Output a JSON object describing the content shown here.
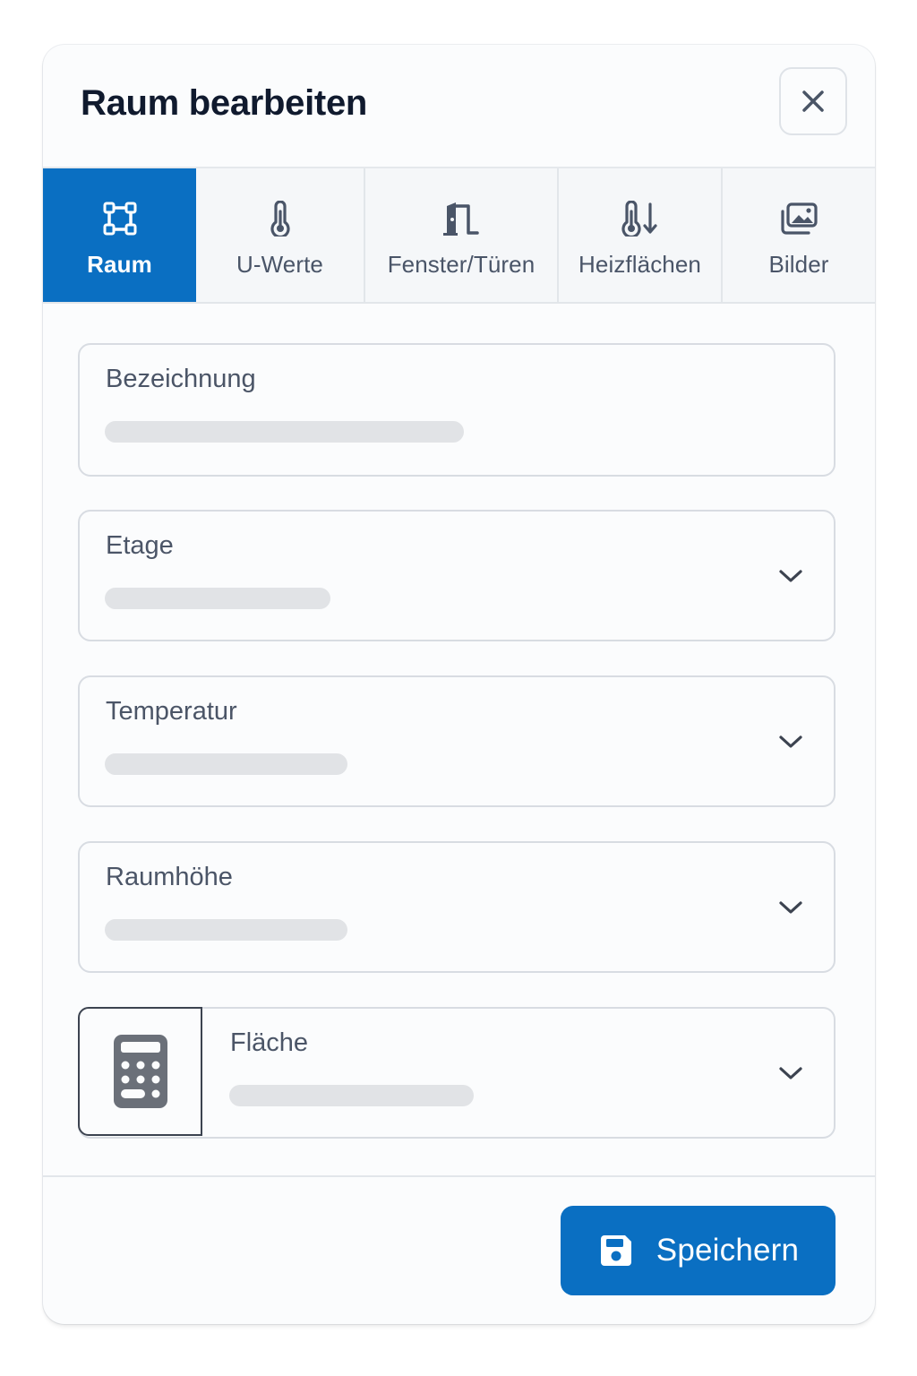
{
  "dialog": {
    "title": "Raum bearbeiten",
    "close_icon": "close-icon"
  },
  "tabs": [
    {
      "label": "Raum",
      "icon": "room-frame-icon",
      "active": true
    },
    {
      "label": "U-Werte",
      "icon": "thermometer-icon",
      "active": false
    },
    {
      "label": "Fenster/Türen",
      "icon": "door-icon",
      "active": false
    },
    {
      "label": "Heizflächen",
      "icon": "thermometer-down-icon",
      "active": false
    },
    {
      "label": "Bilder",
      "icon": "images-icon",
      "active": false
    }
  ],
  "fields": {
    "bezeichnung": {
      "label": "Bezeichnung"
    },
    "etage": {
      "label": "Etage"
    },
    "temperatur": {
      "label": "Temperatur"
    },
    "raumhoehe": {
      "label": "Raumhöhe"
    },
    "flaeche": {
      "label": "Fläche",
      "addon_icon": "calculator-icon"
    }
  },
  "footer": {
    "save_label": "Speichern",
    "save_icon": "save-icon"
  },
  "colors": {
    "accent": "#0a6fc2",
    "title": "#101a2e",
    "label": "#4b5567",
    "border": "#d8dce2",
    "placeholder": "#e1e3e6"
  }
}
